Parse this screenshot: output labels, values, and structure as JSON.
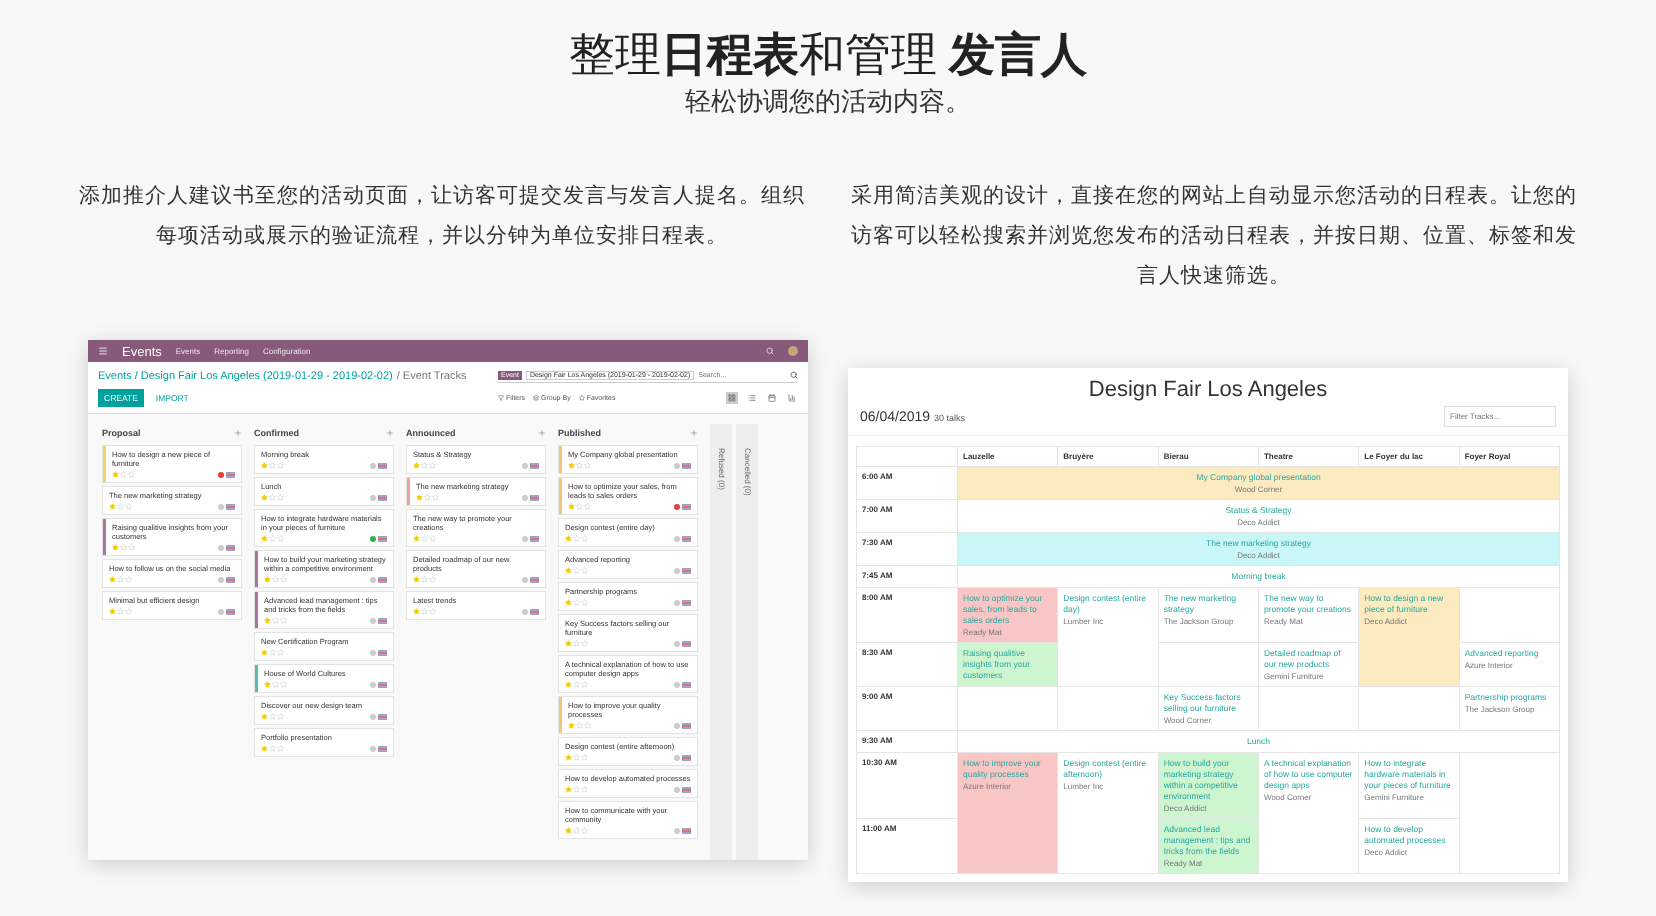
{
  "header": {
    "title": "整理**日程表**和管理 **发言人**",
    "subtitle": "轻松协调您的活动内容。"
  },
  "features": [
    {
      "text": "添加推介人建议书至您的活动页面，让访客可提交发言与发言人提名。组织每项活动或展示的验证流程，并以分钟为单位安排日程表。"
    },
    {
      "text": "采用简洁美观的设计，直接在您的网站上自动显示您活动的日程表。让您的访客可以轻松搜索并浏览您发布的活动日程表，并按日期、位置、标签和发言人快速筛选。"
    }
  ],
  "kanban": {
    "app_name": "Events",
    "menu": [
      "Events",
      "Reporting",
      "Configuration"
    ],
    "breadcrumb_link": "Events / Design Fair Los Angeles (2019-01-29 - 2019-02-02)",
    "breadcrumb_current": "/ Event Tracks",
    "facet_label": "Event",
    "facet_value": "Design Fair Los Angeles (2019-01-29 - 2019-02-02)",
    "search_placeholder": "Search...",
    "buttons": [
      "CREATE",
      "IMPORT"
    ],
    "filters": [
      "Filters",
      "Group By",
      "Favorites"
    ],
    "columns": [
      {
        "title": "Proposal",
        "cards": [
          {
            "title": "How to design a new piece of furniture",
            "stars": 1,
            "status": {
              "color": "#e53e3e"
            },
            "color": "#f4d35e"
          },
          {
            "title": "The new marketing strategy",
            "stars": 1
          },
          {
            "title": "Raising qualitive insights from your customers",
            "stars": 1,
            "color": "#a7769b"
          },
          {
            "title": "How to follow us on the social media",
            "stars": 1
          },
          {
            "title": "Minimal but efficient design",
            "stars": 1
          }
        ]
      },
      {
        "title": "Confirmed",
        "cards": [
          {
            "title": "Morning break",
            "stars": 1
          },
          {
            "title": "Lunch",
            "stars": 1
          },
          {
            "title": "How to integrate hardware materials in your pieces of furniture",
            "stars": 1,
            "status": {
              "color": "#2fb344"
            }
          },
          {
            "title": "How to build your marketing strategy within a competitive environment",
            "stars": 1,
            "color": "#a7769b"
          },
          {
            "title": "Advanced lead management : tips and tricks from the fields",
            "stars": 1,
            "color": "#a7769b"
          },
          {
            "title": "New Certification Program",
            "stars": 1
          },
          {
            "title": "House of World Cultures",
            "stars": 1,
            "color": "#5bbcb0"
          },
          {
            "title": "Discover our new design team",
            "stars": 1
          },
          {
            "title": "Portfolio presentation",
            "stars": 1
          }
        ]
      },
      {
        "title": "Announced",
        "cards": [
          {
            "title": "Status & Strategy",
            "stars": 1
          },
          {
            "title": "The new marketing strategy",
            "stars": 1,
            "color": "#e9a3a3"
          },
          {
            "title": "The new way to promote your creations",
            "stars": 1
          },
          {
            "title": "Detailed roadmap of our new products",
            "stars": 1
          },
          {
            "title": "Latest trends",
            "stars": 1
          }
        ]
      },
      {
        "title": "Published",
        "cards": [
          {
            "title": "My Company global presentation",
            "stars": 1,
            "color": "#f5c67a"
          },
          {
            "title": "How to optimize your sales, from leads to sales orders",
            "stars": 1,
            "status": {
              "color": "#e53e3e"
            },
            "color": "#f5c67a"
          },
          {
            "title": "Design contest (entire day)",
            "stars": 1
          },
          {
            "title": "Advanced reporting",
            "stars": 1
          },
          {
            "title": "Partnership programs",
            "stars": 1
          },
          {
            "title": "Key Success factors selling our furniture",
            "stars": 1
          },
          {
            "title": "A technical explanation of how to use computer design apps",
            "stars": 1
          },
          {
            "title": "How to improve your quality processes",
            "stars": 1,
            "color": "#f5c67a"
          },
          {
            "title": "Design contest (entire afternoon)",
            "stars": 1
          },
          {
            "title": "How to develop automated processes",
            "stars": 1
          },
          {
            "title": "How to communicate with your community",
            "stars": 1
          }
        ]
      }
    ],
    "folded_columns": [
      "Refused (0)",
      "Cancelled (0)"
    ]
  },
  "agenda": {
    "title": "Design Fair Los Angeles",
    "date": "06/04/2019",
    "count": "30 talks",
    "filter_placeholder": "Filter Tracks...",
    "locations": [
      "Lauzelle",
      "Bruyère",
      "Bierau",
      "Theatre",
      "Le Foyer du lac",
      "Foyer Royal"
    ],
    "rows": [
      {
        "time": "6:00 AM",
        "kind": "plenary",
        "talk": {
          "title": "My Company global presentation",
          "speaker": "Wood Corner",
          "color": "#fcebc0"
        }
      },
      {
        "time": "7:00 AM",
        "kind": "plenary",
        "talk": {
          "title": "Status & Strategy",
          "speaker": "Deco Addict"
        }
      },
      {
        "time": "7:30 AM",
        "kind": "plenary",
        "talk": {
          "title": "The new marketing strategy",
          "speaker": "Deco Addict",
          "color": "#c9f7f7"
        }
      },
      {
        "time": "7:45 AM",
        "kind": "plenary",
        "talk": {
          "title": "Morning break"
        }
      },
      {
        "time": "8:00 AM",
        "kind": "tracks",
        "cells": [
          {
            "kind": "talk",
            "title": "How to optimize your sales, from leads to sales orders",
            "speaker": "Ready Mat",
            "color": "#f9c6c6"
          },
          {
            "kind": "talk",
            "title": "Design contest (entire day)",
            "speaker": "Lumber Inc"
          },
          {
            "kind": "talk",
            "title": "The new marketing strategy",
            "speaker": "The Jackson Group"
          },
          {
            "kind": "talk",
            "title": "The new way to promote your creations",
            "speaker": "Ready Mat"
          },
          {
            "kind": "talk",
            "title": "How to design a new piece of furniture",
            "speaker": "Deco Addict",
            "color": "#fcebc0"
          },
          {
            "kind": "empty"
          }
        ]
      },
      {
        "time": "8:30 AM",
        "kind": "tracks",
        "cells": [
          {
            "kind": "talk",
            "title": "Raising qualitive insights from your customers",
            "color": "#cdf5d0"
          },
          {
            "kind": "continued"
          },
          {
            "kind": "empty"
          },
          {
            "kind": "talk",
            "title": "Detailed roadmap of our new products",
            "speaker": "Gemini Furniture"
          },
          {
            "kind": "continued"
          },
          {
            "kind": "talk",
            "title": "Advanced reporting",
            "speaker": "Azure Interior"
          }
        ]
      },
      {
        "time": "9:00 AM",
        "kind": "tracks",
        "cells": [
          {
            "kind": "empty"
          },
          {
            "kind": "empty"
          },
          {
            "kind": "talk",
            "title": "Key Success factors selling our furniture",
            "speaker": "Wood Corner"
          },
          {
            "kind": "empty"
          },
          {
            "kind": "empty"
          },
          {
            "kind": "talk",
            "title": "Partnership programs",
            "speaker": "The Jackson Group"
          }
        ]
      },
      {
        "time": "9:30 AM",
        "kind": "plenary",
        "talk": {
          "title": "Lunch"
        }
      },
      {
        "time": "10:30 AM",
        "kind": "tracks",
        "cells": [
          {
            "kind": "talk",
            "title": "How to improve your quality processes",
            "speaker": "Azure Interior",
            "color": "#f9c6c6"
          },
          {
            "kind": "talk",
            "title": "Design contest (entire afternoon)",
            "speaker": "Lumber Inc"
          },
          {
            "kind": "talk",
            "title": "How to build your marketing strategy within a competitive environment",
            "speaker": "Deco Addict",
            "color": "#cdf5d0"
          },
          {
            "kind": "talk",
            "title": "A technical explanation of how to use computer design apps",
            "speaker": "Wood Corner"
          },
          {
            "kind": "talk",
            "title": "How to integrate hardware materials in your pieces of furniture",
            "speaker": "Gemini Furniture"
          },
          {
            "kind": "empty"
          }
        ]
      },
      {
        "time": "11:00 AM",
        "kind": "tracks",
        "cells": [
          {
            "kind": "continued"
          },
          {
            "kind": "continued"
          },
          {
            "kind": "talk",
            "title": "Advanced lead management : tips and tricks from the fields",
            "speaker": "Ready Mat",
            "color": "#cdf5d0"
          },
          {
            "kind": "continued"
          },
          {
            "kind": "talk",
            "title": "How to develop automated processes",
            "speaker": "Deco Addict"
          },
          {
            "kind": "continued"
          }
        ]
      }
    ]
  }
}
